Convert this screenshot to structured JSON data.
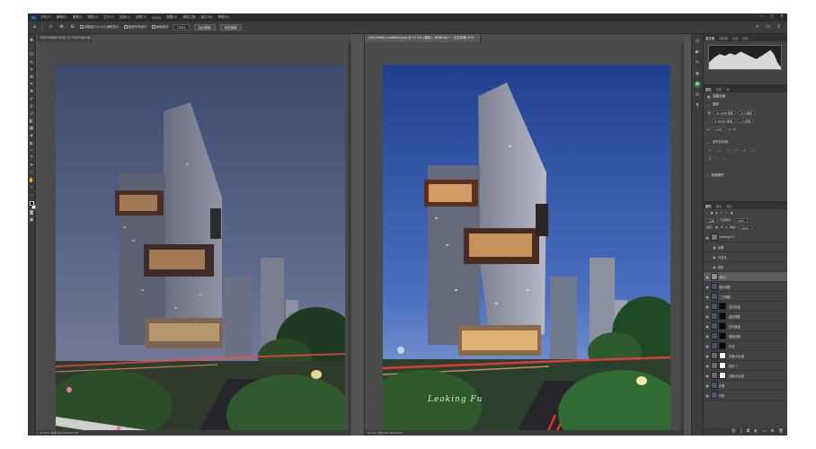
{
  "app": {
    "logo": "Ps",
    "menu": [
      "文件(F)",
      "编辑(E)",
      "图像(I)",
      "图层(L)",
      "文字(Y)",
      "选择(S)",
      "滤镜(T)",
      "3D(D)",
      "视图(V)",
      "增效工具",
      "窗口(W)",
      "帮助(H)"
    ],
    "window_controls": [
      "—",
      "□",
      "✕"
    ]
  },
  "options_bar": {
    "resize_label": "调整窗口大小以满屏显示",
    "zoom_all_label": "缩放所有窗口",
    "scrubby_label": "细微缩放",
    "zoom_value": "100%",
    "fit_screen": "适合屏幕",
    "fill_screen": "填充屏幕"
  },
  "documents": {
    "left": {
      "tab": "DSC09908.tif @ 11.7%(RGB/16)",
      "status": "11.67%   文档:135.2M/135.2M"
    },
    "right": {
      "tab": "DSC09908_modified.psb @ 12.5% (调色1, RGB/16) * · 正在存储 37%",
      "status": "12.5%   文档:135.2M/2.81G"
    }
  },
  "watermark": "Leaking Fu",
  "panels": {
    "histogram_tabs": [
      "直方图",
      "导航器",
      "信息",
      "颜色"
    ],
    "properties_tabs": [
      "属性",
      "调整",
      "库"
    ],
    "properties": {
      "title": "智能对象",
      "transform_head": "变换",
      "w": "W 7098 像素",
      "h": "H 10646 像素",
      "x": "X 0 像素",
      "y": "Y 0 像素",
      "angle": "0.00°",
      "align_head": "对齐并分布",
      "quick_head": "快速操作"
    },
    "layers_tabs": [
      "图层",
      "通道",
      "路径"
    ],
    "blend_mode": "正常",
    "opacity_label": "不透明度:",
    "opacity_value": "100%",
    "lock_label": "锁定:",
    "fill_label": "填充:",
    "fill_value": "100%",
    "layers": [
      {
        "name": "Leaking Fu",
        "thumb": "#777777",
        "mask": "",
        "selected": false
      },
      {
        "name": "效果",
        "thumb": "",
        "mask": "",
        "selected": false
      },
      {
        "name": "外发光",
        "thumb": "",
        "mask": "",
        "selected": false
      },
      {
        "name": "投影",
        "thumb": "",
        "mask": "",
        "selected": false
      },
      {
        "name": "调色1",
        "thumb": "#8f8f8f",
        "mask": "",
        "selected": true
      },
      {
        "name": "盖印调整",
        "thumb": "#44536e",
        "mask": "",
        "selected": false
      },
      {
        "name": "二次调整",
        "thumb": "#44536e",
        "mask": "",
        "selected": false
      },
      {
        "name": "高光保留",
        "thumb": "#44536e",
        "mask": "#0a0a0a",
        "selected": false
      },
      {
        "name": "曲线调整",
        "thumb": "#44536e",
        "mask": "#0a0a0a",
        "selected": false
      },
      {
        "name": "高光保留",
        "thumb": "#44536e",
        "mask": "#0a0a0a",
        "selected": false
      },
      {
        "name": "暗部压暗",
        "thumb": "#44536e",
        "mask": "#0a0a0a",
        "selected": false
      },
      {
        "name": "车流",
        "thumb": "#44536e",
        "mask": "#0a0a0a",
        "selected": false
      },
      {
        "name": "亮度/对比度",
        "thumb": "#6a6a6a",
        "mask": "#f2f2f2",
        "selected": false
      },
      {
        "name": "色阶 1",
        "thumb": "#6a6a6a",
        "mask": "#f2f2f2",
        "selected": false
      },
      {
        "name": "亮度/对比度",
        "thumb": "#6a6a6a",
        "mask": "#f2f2f2",
        "selected": false
      },
      {
        "name": "压暗",
        "thumb": "#44536e",
        "mask": "",
        "selected": false
      },
      {
        "name": "背景",
        "thumb": "#44536e",
        "mask": "",
        "selected": false
      }
    ]
  },
  "colors": {
    "app_bg": "#535353",
    "menubar": "#2b2b2b",
    "panel": "#424242",
    "selected_layer": "#5b5b5b",
    "active_panel_icon": "#2c7a3b"
  }
}
